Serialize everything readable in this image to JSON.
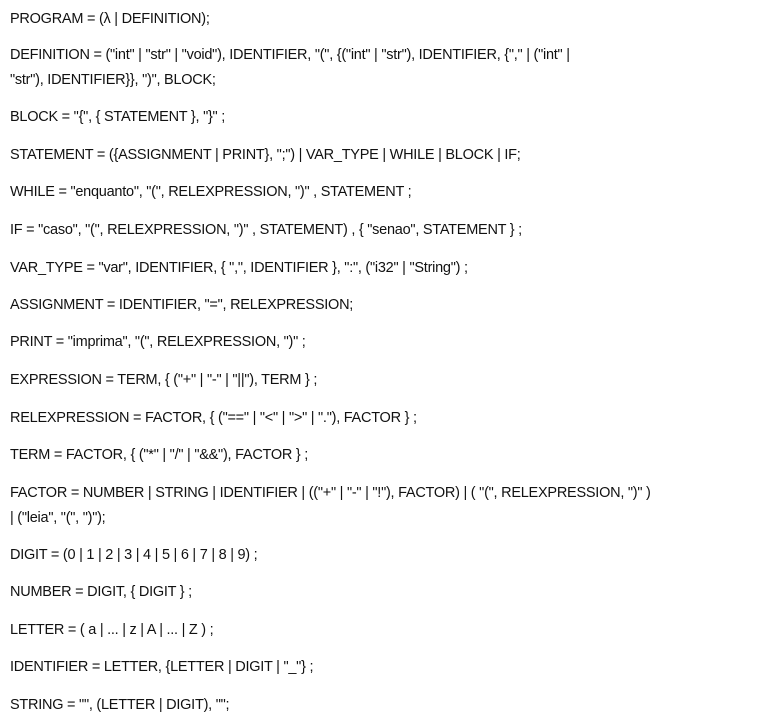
{
  "rules": [
    [
      "PROGRAM = (λ | DEFINITION);"
    ],
    [
      "DEFINITION = (\"int\" | \"str\" | \"void\"), IDENTIFIER, \"(\", {(\"int\" | \"str\"), IDENTIFIER, {\",\" | (\"int\" |",
      "\"str\"), IDENTIFIER}}, \")\", BLOCK;"
    ],
    [
      "BLOCK = \"{\", { STATEMENT }, \"}\" ;"
    ],
    [
      "STATEMENT = ({ASSIGNMENT | PRINT}, \";\") | VAR_TYPE | WHILE | BLOCK | IF;"
    ],
    [
      "WHILE = \"enquanto\", \"(\", RELEXPRESSION, \")\" , STATEMENT ;"
    ],
    [
      "IF = \"caso\", \"(\", RELEXPRESSION, \")\" , STATEMENT) , { \"senao\", STATEMENT } ;"
    ],
    [
      "VAR_TYPE = \"var\", IDENTIFIER, { \",\", IDENTIFIER }, \":\", (\"i32\" | \"String\") ;"
    ],
    [
      "ASSIGNMENT = IDENTIFIER, \"=\", RELEXPRESSION;"
    ],
    [
      "PRINT = \"imprima\", \"(\", RELEXPRESSION, \")\" ;"
    ],
    [
      "EXPRESSION = TERM, { (\"+\" | \"-\" | \"||\"), TERM } ;"
    ],
    [
      "RELEXPRESSION = FACTOR, { (\"==\" | \"<\" | \">\" | \".\"), FACTOR } ;"
    ],
    [
      "TERM = FACTOR, { (\"*\" | \"/\" | \"&&\"), FACTOR } ;"
    ],
    [
      "FACTOR = NUMBER | STRING | IDENTIFIER | ((\"+\" | \"-\" | \"!\"), FACTOR) | ( \"(\", RELEXPRESSION, \")\" )",
      "| (\"leia\", \"(\", \")\");"
    ],
    [
      "DIGIT = (0 | 1 | 2 | 3 | 4 | 5 | 6 | 7 | 8 | 9) ;"
    ],
    [
      "NUMBER = DIGIT, { DIGIT } ;"
    ],
    [
      "LETTER = ( a | ... | z | A | ... | Z ) ;"
    ],
    [
      "IDENTIFIER = LETTER, {LETTER | DIGIT | \"_\"} ;"
    ],
    [
      "STRING = \"\", (LETTER | DIGIT), \"\";"
    ]
  ]
}
